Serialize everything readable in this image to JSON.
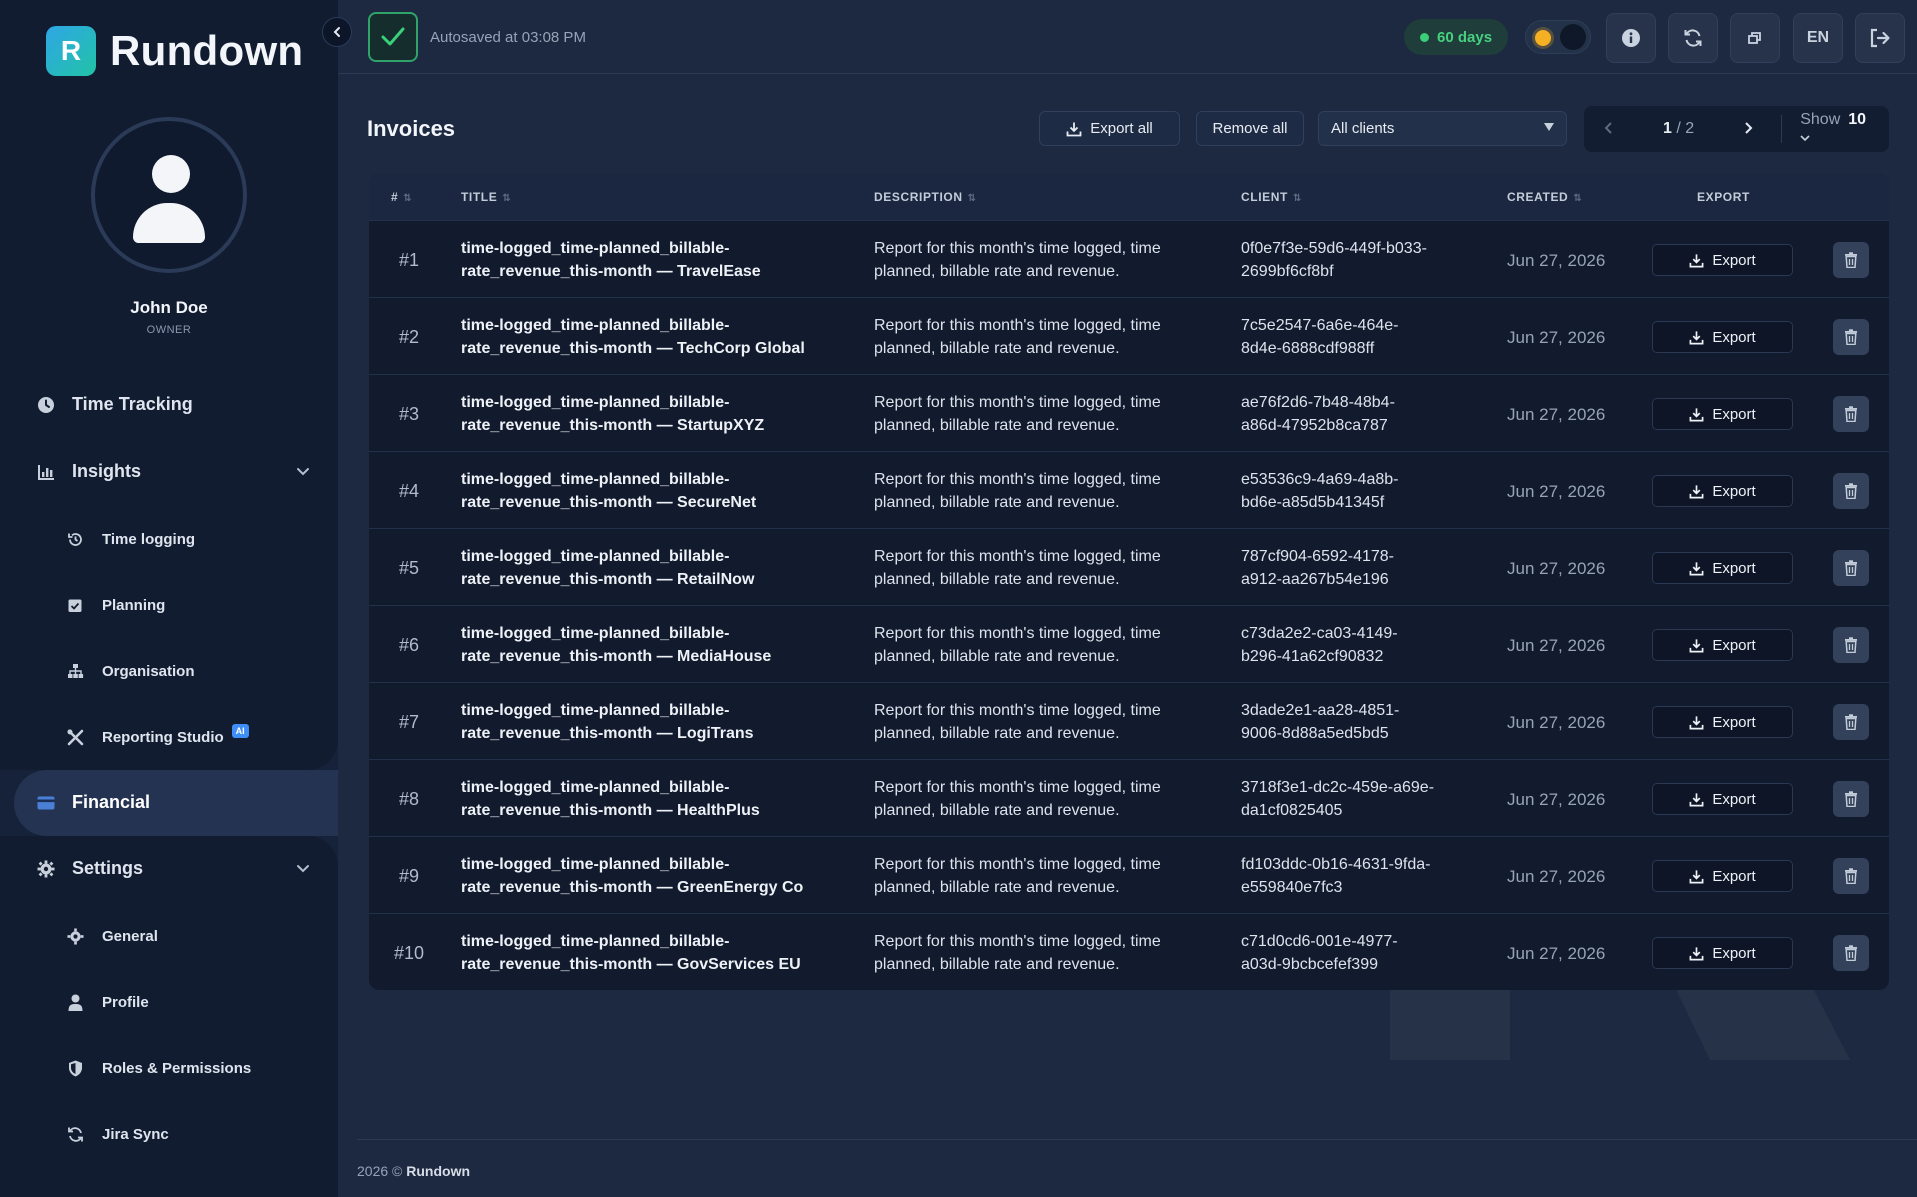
{
  "app": {
    "logo_letter": "R",
    "name": "Rundown"
  },
  "user": {
    "name": "John Doe",
    "role": "OWNER"
  },
  "nav": {
    "time_tracking": "Time Tracking",
    "insights": "Insights",
    "time_logging": "Time logging",
    "planning": "Planning",
    "organisation": "Organisation",
    "reporting_studio": "Reporting Studio",
    "ai_badge": "AI",
    "financial": "Financial",
    "settings": "Settings",
    "general": "General",
    "profile": "Profile",
    "roles": "Roles & Permissions",
    "jira_sync": "Jira Sync"
  },
  "header": {
    "autosave": "Autosaved at 03:08 PM",
    "days_badge": "60 days",
    "lang": "EN"
  },
  "toolbar": {
    "title": "Invoices",
    "export_all": "Export all",
    "remove_all": "Remove all",
    "client_filter": "All clients",
    "page_current": "1",
    "page_total": "/ 2",
    "show_label": "Show",
    "show_value": "10"
  },
  "table": {
    "headers": {
      "num": "#",
      "title": "TITLE",
      "description": "DESCRIPTION",
      "client": "CLIENT",
      "created": "CREATED",
      "export": "EXPORT"
    },
    "export_label": "Export",
    "rows": [
      {
        "num": "#1",
        "title_line1": "time-logged_time-planned_billable-",
        "title_line2": "rate_revenue_this-month — TravelEase",
        "desc_line1": "Report for this month's time logged, time",
        "desc_line2": "planned, billable rate and revenue.",
        "client_line1": "0f0e7f3e-59d6-449f-b033-",
        "client_line2": "2699bf6cf8bf",
        "created": "Jun 27, 2026"
      },
      {
        "num": "#2",
        "title_line1": "time-logged_time-planned_billable-",
        "title_line2": "rate_revenue_this-month — TechCorp Global",
        "desc_line1": "Report for this month's time logged, time",
        "desc_line2": "planned, billable rate and revenue.",
        "client_line1": "7c5e2547-6a6e-464e-",
        "client_line2": "8d4e-6888cdf988ff",
        "created": "Jun 27, 2026"
      },
      {
        "num": "#3",
        "title_line1": "time-logged_time-planned_billable-",
        "title_line2": "rate_revenue_this-month — StartupXYZ",
        "desc_line1": "Report for this month's time logged, time",
        "desc_line2": "planned, billable rate and revenue.",
        "client_line1": "ae76f2d6-7b48-48b4-",
        "client_line2": "a86d-47952b8ca787",
        "created": "Jun 27, 2026"
      },
      {
        "num": "#4",
        "title_line1": "time-logged_time-planned_billable-",
        "title_line2": "rate_revenue_this-month — SecureNet",
        "desc_line1": "Report for this month's time logged, time",
        "desc_line2": "planned, billable rate and revenue.",
        "client_line1": "e53536c9-4a69-4a8b-",
        "client_line2": "bd6e-a85d5b41345f",
        "created": "Jun 27, 2026"
      },
      {
        "num": "#5",
        "title_line1": "time-logged_time-planned_billable-",
        "title_line2": "rate_revenue_this-month — RetailNow",
        "desc_line1": "Report for this month's time logged, time",
        "desc_line2": "planned, billable rate and revenue.",
        "client_line1": "787cf904-6592-4178-",
        "client_line2": "a912-aa267b54e196",
        "created": "Jun 27, 2026"
      },
      {
        "num": "#6",
        "title_line1": "time-logged_time-planned_billable-",
        "title_line2": "rate_revenue_this-month — MediaHouse",
        "desc_line1": "Report for this month's time logged, time",
        "desc_line2": "planned, billable rate and revenue.",
        "client_line1": "c73da2e2-ca03-4149-",
        "client_line2": "b296-41a62cf90832",
        "created": "Jun 27, 2026"
      },
      {
        "num": "#7",
        "title_line1": "time-logged_time-planned_billable-",
        "title_line2": "rate_revenue_this-month — LogiTrans",
        "desc_line1": "Report for this month's time logged, time",
        "desc_line2": "planned, billable rate and revenue.",
        "client_line1": "3dade2e1-aa28-4851-",
        "client_line2": "9006-8d88a5ed5bd5",
        "created": "Jun 27, 2026"
      },
      {
        "num": "#8",
        "title_line1": "time-logged_time-planned_billable-",
        "title_line2": "rate_revenue_this-month — HealthPlus",
        "desc_line1": "Report for this month's time logged, time",
        "desc_line2": "planned, billable rate and revenue.",
        "client_line1": "3718f3e1-dc2c-459e-a69e-",
        "client_line2": "da1cf0825405",
        "created": "Jun 27, 2026"
      },
      {
        "num": "#9",
        "title_line1": "time-logged_time-planned_billable-",
        "title_line2": "rate_revenue_this-month — GreenEnergy Co",
        "desc_line1": "Report for this month's time logged, time",
        "desc_line2": "planned, billable rate and revenue.",
        "client_line1": "fd103ddc-0b16-4631-9fda-",
        "client_line2": "e559840e7fc3",
        "created": "Jun 27, 2026"
      },
      {
        "num": "#10",
        "title_line1": "time-logged_time-planned_billable-",
        "title_line2": "rate_revenue_this-month — GovServices EU",
        "desc_line1": "Report for this month's time logged, time",
        "desc_line2": "planned, billable rate and revenue.",
        "client_line1": "c71d0cd6-001e-4977-",
        "client_line2": "a03d-9bcbcefef399",
        "created": "Jun 27, 2026"
      }
    ]
  },
  "footer": {
    "year": "2026 ©",
    "brand": "Rundown"
  },
  "colors": {
    "accent_green": "#3ad07a",
    "sun": "#f5b024",
    "ai_badge": "#3f8ef7"
  }
}
